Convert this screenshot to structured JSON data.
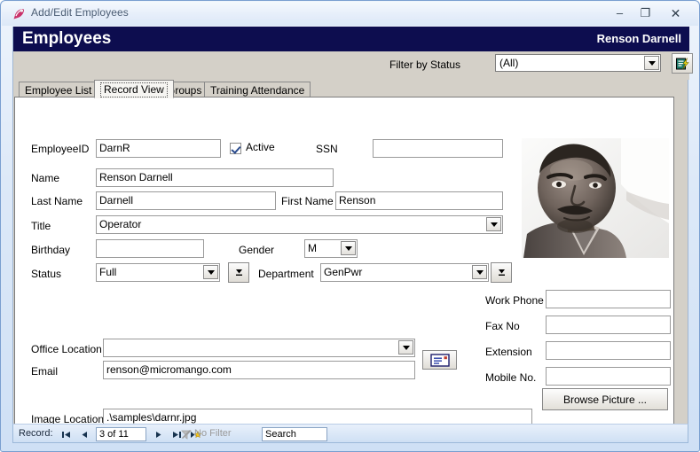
{
  "window": {
    "title": "Add/Edit Employees",
    "app_icon": "feather-pen-icon",
    "minimize": "–",
    "maximize": "❐",
    "close": "✕"
  },
  "header": {
    "title": "Employees",
    "person": "Renson Darnell",
    "background": "#0d0d4f"
  },
  "filter": {
    "label": "Filter by Status",
    "value": "(All)",
    "edit_button_icon": "edit-record-icon"
  },
  "tabs": [
    {
      "label": "Employee List",
      "active": false
    },
    {
      "label": "Record View",
      "active": true
    },
    {
      "label": "Groups",
      "active": false
    },
    {
      "label": "Training Attendance",
      "active": false
    }
  ],
  "form": {
    "employee_id": {
      "label": "EmployeeID",
      "value": "DarnR"
    },
    "active": {
      "label": "Active",
      "checked": true
    },
    "ssn": {
      "label": "SSN",
      "value": ""
    },
    "name": {
      "label": "Name",
      "value": "Renson Darnell"
    },
    "last_name": {
      "label": "Last Name",
      "value": "Darnell"
    },
    "first_name": {
      "label": "First Name",
      "value": "Renson"
    },
    "title": {
      "label": "Title",
      "value": "Operator"
    },
    "birthday": {
      "label": "Birthday",
      "value": ""
    },
    "gender": {
      "label": "Gender",
      "value": "M"
    },
    "status": {
      "label": "Status",
      "value": "Full"
    },
    "department": {
      "label": "Department",
      "value": "GenPwr"
    },
    "work_phone": {
      "label": "Work Phone",
      "value": ""
    },
    "fax_no": {
      "label": "Fax No",
      "value": ""
    },
    "extension": {
      "label": "Extension",
      "value": ""
    },
    "mobile_no": {
      "label": "Mobile No.",
      "value": ""
    },
    "office_location": {
      "label": "Office Location",
      "value": ""
    },
    "email": {
      "label": "Email",
      "value": "renson@micromango.com",
      "button_icon": "envelope-icon"
    },
    "image_location": {
      "label": "Image Location",
      "value": ".\\samples\\darnr.jpg"
    },
    "browse_picture": "Browse Picture ...",
    "photo_alt": "employee-photo-portrait"
  },
  "statusbar": {
    "record_label": "Record:",
    "record_position": "3 of 11",
    "first_icon": "⏮",
    "prev_icon": "◀",
    "next_icon": "▶",
    "last_icon": "⏭",
    "new_icon": "▶",
    "filter_text": "No Filter",
    "search_text": "Search"
  }
}
